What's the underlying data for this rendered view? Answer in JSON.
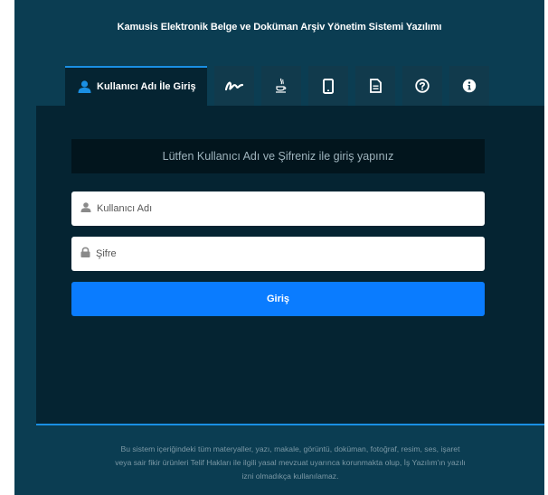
{
  "app": {
    "title": "Kamusis Elektronik Belge ve Doküman Arşiv Yönetim Sistemi Yazılımı"
  },
  "tabs": [
    {
      "label": "Kullanıcı Adı İle Giriş",
      "icon": "user-icon",
      "active": true
    },
    {
      "icon": "e-signature-icon"
    },
    {
      "icon": "java-icon"
    },
    {
      "icon": "mobile-icon"
    },
    {
      "icon": "document-icon"
    },
    {
      "icon": "help-icon"
    },
    {
      "icon": "info-icon"
    }
  ],
  "login": {
    "prompt": "Lütfen Kullanıcı Adı ve Şifreniz ile giriş yapınız",
    "username_placeholder": "Kullanıcı Adı",
    "password_placeholder": "Şifre",
    "submit_label": "Giriş"
  },
  "footer": {
    "line1": "Bu sistem içeriğindeki tüm materyaller, yazı, makale, görüntü, doküman, fotoğraf, resim, ses, işaret",
    "line2": "veya sair fikir ürünleri Telif Hakları ile ilgili yasal mevzuat uyarınca korunmakta olup, İş Yazılım'ın yazılı",
    "line3": "izni olmadıkça kullanılamaz."
  },
  "colors": {
    "background": "#0b3d52",
    "panel": "#052432",
    "accent": "#1a8fe3",
    "button": "#0a7cff"
  }
}
